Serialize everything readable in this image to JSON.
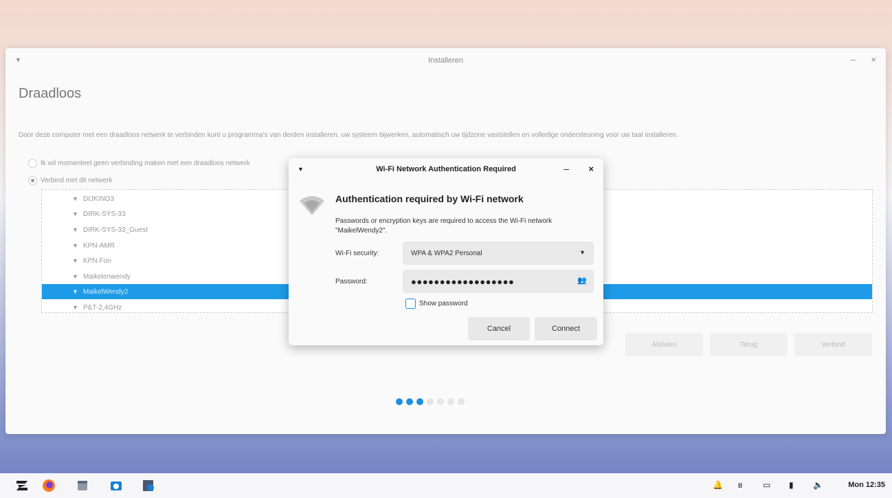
{
  "installer": {
    "title": "Installeren",
    "heading": "Draadloos",
    "description": "Door deze computer met een draadloos netwerk te verbinden kunt u programma's van derden installeren, uw systeem bijwerken, automatisch uw tijdzone vaststellen en volledige ondersteuning voor uw taal installeren.",
    "option_no_connection": "Ik wil momenteel geen verbinding maken met een draadloos netwerk",
    "option_connect": "Verbind met dit netwerk",
    "networks": [
      {
        "name": "DIJKINO3",
        "selected": false
      },
      {
        "name": "DIRK-SYS-33",
        "selected": false
      },
      {
        "name": "DIRK-SYS-33_Guest",
        "selected": false
      },
      {
        "name": "KPN-AMR",
        "selected": false
      },
      {
        "name": "KPN Fon",
        "selected": false
      },
      {
        "name": "Maikelenwendy",
        "selected": false
      },
      {
        "name": "MaikelWendy2",
        "selected": true
      },
      {
        "name": "P&T-2,4GHz",
        "selected": false
      }
    ],
    "buttons": {
      "quit": "Afsluten",
      "back": "Terug",
      "connect": "Verbind"
    },
    "progress": {
      "total_steps": 7,
      "completed_steps": 3
    }
  },
  "dialog": {
    "title": "Wi-Fi Network Authentication Required",
    "heading": "Authentication required by Wi-Fi network",
    "message": "Passwords or encryption keys are required to access the Wi-Fi network \"MaikelWendy2\".",
    "security_label": "Wi-Fi security:",
    "security_value": "WPA & WPA2 Personal",
    "password_label": "Password:",
    "password_mask": "●●●●●●●●●●●●●●●●●●",
    "show_password_label": "Show password",
    "cancel_label": "Cancel",
    "connect_label": "Connect"
  },
  "taskbar": {
    "clock": "Mon 12:35",
    "apps": [
      "zorin-menu-icon",
      "firefox-icon",
      "files-icon",
      "camera-icon",
      "installer-icon"
    ]
  },
  "colors": {
    "accent": "#1e9be8",
    "selection": "#1e9be8"
  }
}
